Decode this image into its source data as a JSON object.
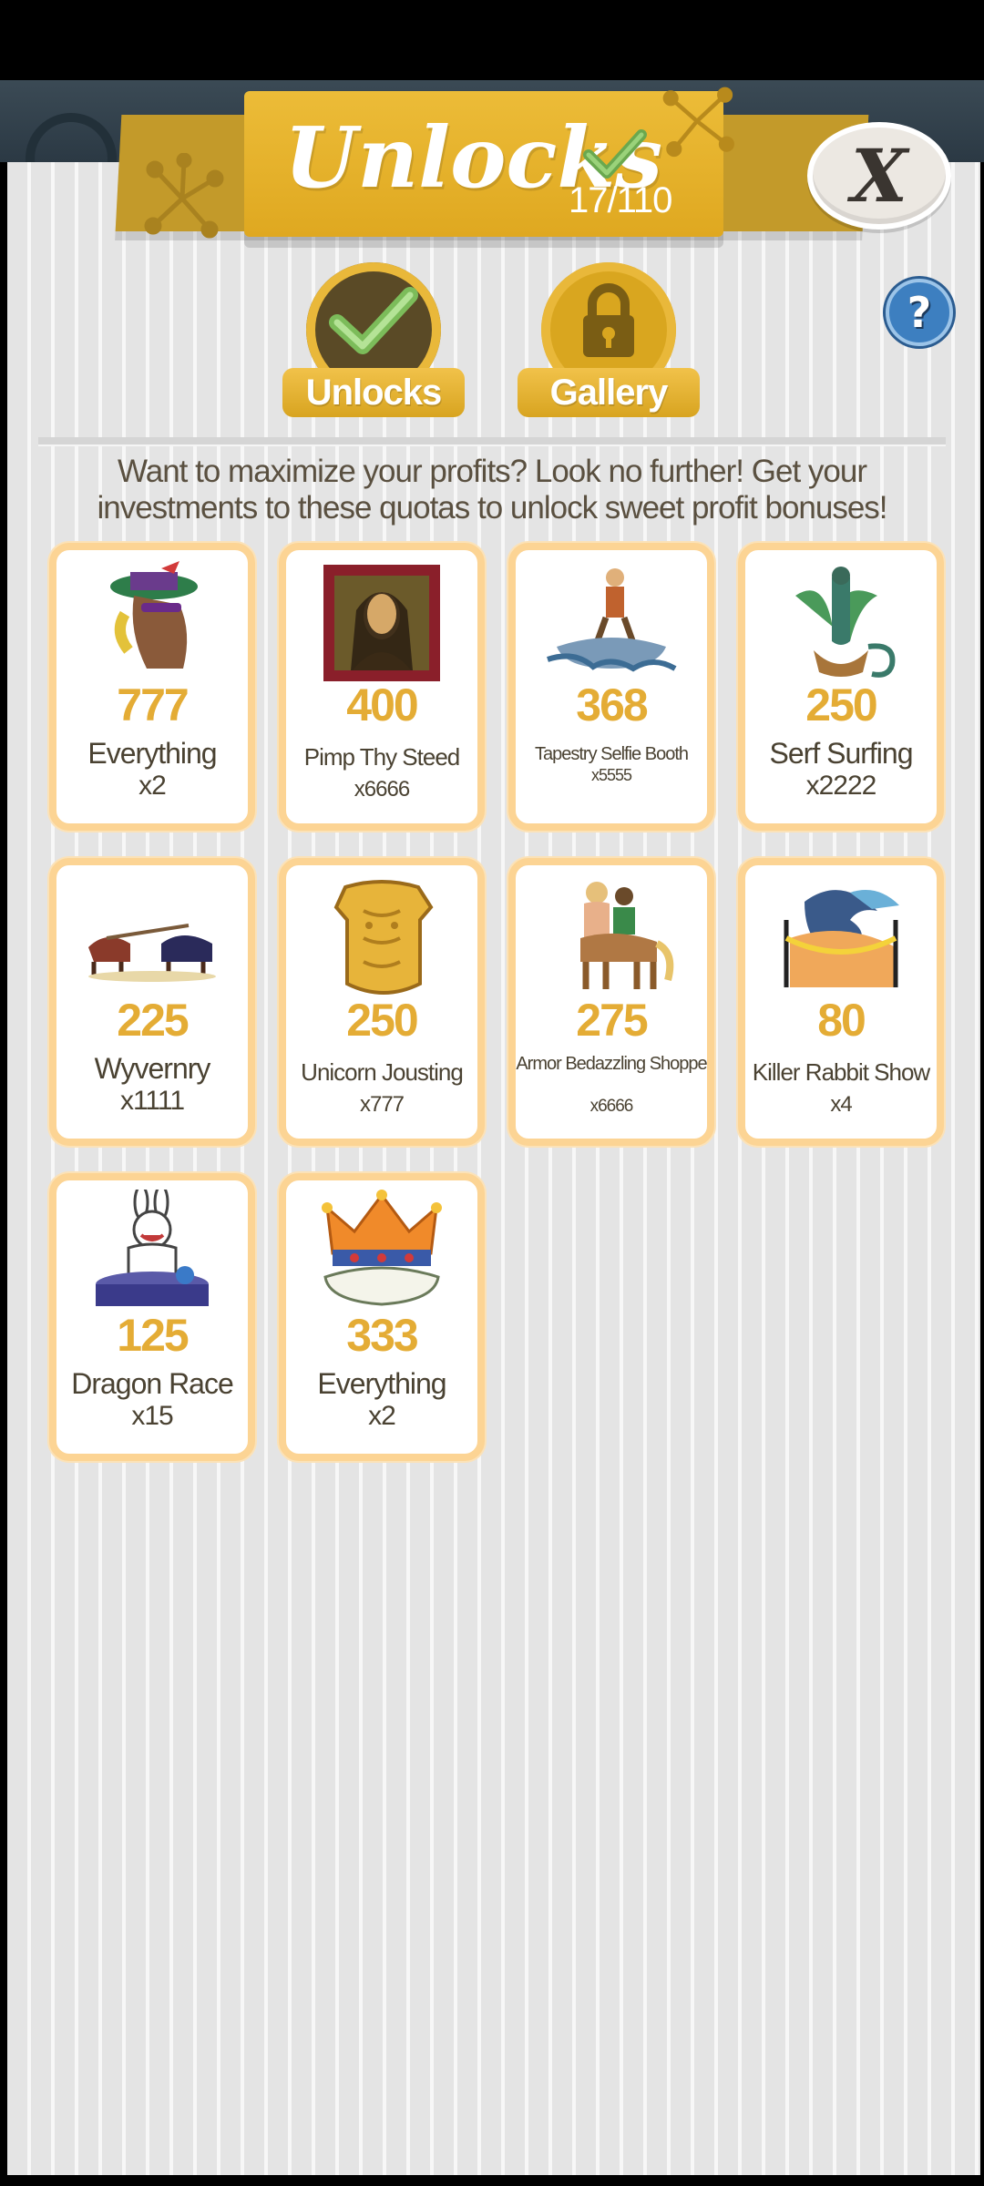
{
  "header": {
    "title": "Unlocks",
    "count": "17/110",
    "close_glyph": "X",
    "help_glyph": "?"
  },
  "tabs": [
    {
      "label": "Unlocks",
      "icon": "check-icon",
      "active": true
    },
    {
      "label": "Gallery",
      "icon": "lock-icon",
      "active": false
    }
  ],
  "intro": "Want to maximize your profits? Look no further! Get your investments to these quotas to unlock sweet profit bonuses!",
  "cards": [
    {
      "value": "777",
      "name": "Everything",
      "mult": "x2",
      "art": "horse-hat-art"
    },
    {
      "value": "400",
      "name": "Pimp Thy Steed",
      "mult": "x6666",
      "art": "mona-lisa-art"
    },
    {
      "value": "368",
      "name": "Tapestry Selfie Booth",
      "mult": "x5555",
      "art": "serf-surf-art"
    },
    {
      "value": "250",
      "name": "Serf Surfing",
      "mult": "x2222",
      "art": "wyvern-art"
    },
    {
      "value": "225",
      "name": "Wyvernry",
      "mult": "x1111",
      "art": "jousting-art"
    },
    {
      "value": "250",
      "name": "Unicorn Jousting",
      "mult": "x777",
      "art": "armor-art"
    },
    {
      "value": "275",
      "name": "Armor Bedazzling Shoppe",
      "mult": "x6666",
      "art": "centaur-art"
    },
    {
      "value": "80",
      "name": "Killer Rabbit Show",
      "mult": "x4",
      "art": "dragon-start-art"
    },
    {
      "value": "125",
      "name": "Dragon Race",
      "mult": "x15",
      "art": "rabbit-podium-art"
    },
    {
      "value": "333",
      "name": "Everything",
      "mult": "x2",
      "art": "crown-art"
    }
  ],
  "colors": {
    "gold": "#e4ac35",
    "banner": "#e6b22c",
    "card_border": "#fcd494",
    "help_blue": "#3d7fc0"
  }
}
